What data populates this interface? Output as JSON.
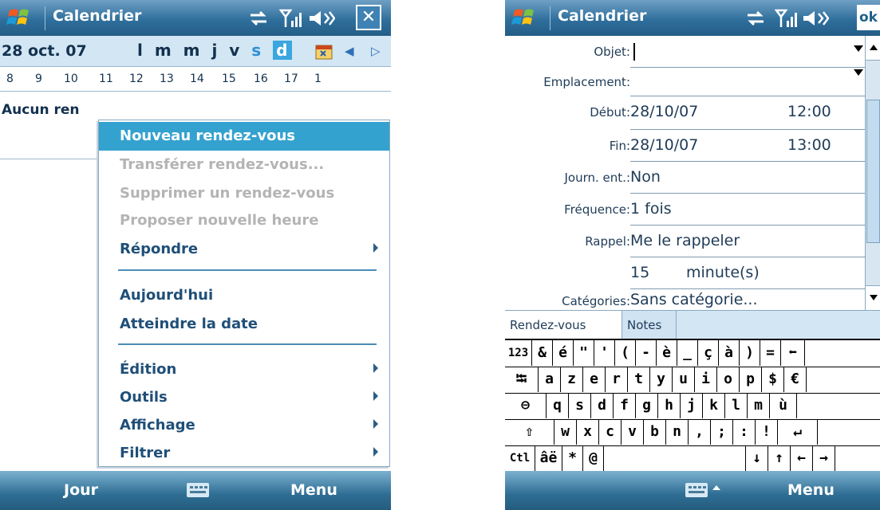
{
  "left": {
    "title": "Calendrier",
    "date": "28 oct. 07",
    "weekdays": [
      "l",
      "m",
      "m",
      "j",
      "v",
      "s",
      "d"
    ],
    "hours": [
      "8",
      "9",
      "10",
      "11",
      "12",
      "13",
      "14",
      "15",
      "16",
      "17",
      "1"
    ],
    "no_appointment": "Aucun ren",
    "menu": {
      "new_appt": "Nouveau rendez-vous",
      "forward": "Transférer rendez-vous...",
      "delete": "Supprimer un rendez-vous",
      "propose": "Proposer nouvelle heure",
      "reply": "Répondre",
      "today": "Aujourd'hui",
      "goto": "Atteindre la date",
      "edit": "Édition",
      "tools": "Outils",
      "view": "Affichage",
      "filter": "Filtrer"
    },
    "softkeys": {
      "left": "Jour",
      "right": "Menu"
    },
    "icons": {
      "close": "close-icon",
      "sync": "sync-icon",
      "signal": "signal-icon",
      "volume": "volume-icon"
    }
  },
  "right": {
    "title": "Calendrier",
    "ok": "ok",
    "fields": {
      "subject_label": "Objet:",
      "subject_value": "",
      "location_label": "Emplacement:",
      "start_label": "Début:",
      "start_date": "28/10/07",
      "start_time": "12:00",
      "end_label": "Fin:",
      "end_date": "28/10/07",
      "end_time": "13:00",
      "allday_label": "Journ. ent.:",
      "allday_value": "Non",
      "freq_label": "Fréquence:",
      "freq_value": "1 fois",
      "reminder_label": "Rappel:",
      "reminder_value": "Me le rappeler",
      "reminder_amount": "15",
      "reminder_unit": "minute(s)",
      "categories_label": "Catégories:",
      "categories_value": "Sans catégorie..."
    },
    "tabs": [
      "Rendez-vous",
      "Notes"
    ],
    "keyboard": {
      "row1": [
        "123",
        "&",
        "é",
        "\"",
        "'",
        "(",
        "-",
        "è",
        "_",
        "ç",
        "à",
        ")",
        "=",
        "⬅"
      ],
      "row2": [
        "⭾",
        "a",
        "z",
        "e",
        "r",
        "t",
        "y",
        "u",
        "i",
        "o",
        "p",
        "$",
        "€"
      ],
      "row3": [
        "⊖",
        "q",
        "s",
        "d",
        "f",
        "g",
        "h",
        "j",
        "k",
        "l",
        "m",
        "ù"
      ],
      "row4": [
        "⇧",
        "w",
        "x",
        "c",
        "v",
        "b",
        "n",
        ",",
        ";",
        ":",
        "!",
        "↵"
      ],
      "row5": [
        "Ctl",
        "âë",
        "*",
        "@",
        "",
        "↓",
        "↑",
        "←",
        "→"
      ]
    },
    "softkeys": {
      "right": "Menu"
    }
  },
  "colors": {
    "titlebar": "#2f6f9c",
    "highlight": "#34a2cf",
    "datebar": "#d3e6f4"
  }
}
